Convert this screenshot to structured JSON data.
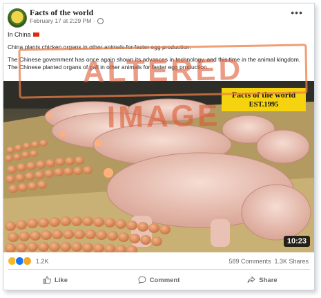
{
  "post": {
    "page_name": "Facts of the world",
    "time": "February 17 at 2:29 PM",
    "location": "In China",
    "caption_title": "China plants chicken organs in other animals for faster egg production.",
    "caption_body": "The Chinese government has once again shown its advances in technology, and this time in the animal kingdom. The Chinese planted organs of gall in other animals for faster egg production.",
    "stamp_text": "ALTERED IMAGE",
    "more_label": "•••"
  },
  "video": {
    "brand_line1": "Facts of the world",
    "brand_line2": "EST.1995",
    "duration": "10:23"
  },
  "engagement": {
    "reaction_count": "1.2K",
    "comments": "589 Comments",
    "shares": "1.3K Shares",
    "reaction_icons": [
      "haha-icon",
      "like-icon",
      "wow-icon"
    ]
  },
  "actions": {
    "like": "Like",
    "comment": "Comment",
    "share": "Share"
  },
  "colors": {
    "accent": "#1877f2",
    "brand_badge": "#f5d30f",
    "stamp": "#e07a4a"
  }
}
